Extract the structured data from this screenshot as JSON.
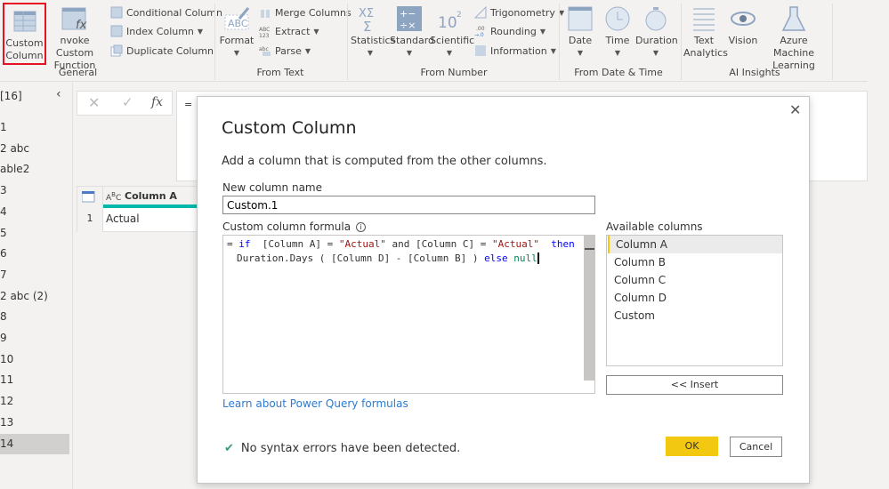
{
  "ribbon": {
    "custom_column": [
      "Custom",
      "Column"
    ],
    "invoke_custom_function": [
      "nvoke Custom",
      "Function"
    ],
    "conditional_column": "Conditional Column",
    "index_column": "Index Column",
    "duplicate_column": "Duplicate Column",
    "general": "General",
    "format": "Format",
    "merge_columns": "Merge Columns",
    "extract": "Extract",
    "parse": "Parse",
    "from_text": "From Text",
    "statistics": "Statistics",
    "standard": "Standard",
    "scientific": "Scientific",
    "trigonometry": "Trigonometry",
    "rounding": "Rounding",
    "information": "Information",
    "from_number": "From Number",
    "date": "Date",
    "time": "Time",
    "duration": "Duration",
    "from_date_time": "From Date & Time",
    "text_analytics": [
      "Text",
      "Analytics"
    ],
    "vision": "Vision",
    "azure_ml": [
      "Azure Machine",
      "Learning"
    ],
    "ai_insights": "AI Insights",
    "highlight_color": "#e81123"
  },
  "sidebar": {
    "header": "[16]",
    "items": [
      "1",
      "2 abc",
      "able2",
      "3",
      "4",
      "5",
      "6",
      "7",
      "2 abc (2)",
      "8",
      "9",
      "10",
      "11",
      "12",
      "13",
      "14"
    ],
    "selected_index": 15
  },
  "formula_bar": {
    "prefix": "=",
    "fx": "fx"
  },
  "grid": {
    "column_header": "Column A",
    "type_icon": "ABC",
    "rows": [
      {
        "num": "1",
        "value": "Actual"
      }
    ]
  },
  "dialog": {
    "title": "Custom Column",
    "description": "Add a column that is computed from the other columns.",
    "new_column_name_label": "New column name",
    "new_column_name_value": "Custom.1",
    "formula_label": "Custom column formula",
    "formula": {
      "eq": "= ",
      "if": "if",
      "p1": "  [Column A] = ",
      "s1": "\"Actual\"",
      "p2": " and [Column C] = ",
      "s2": "\"Actual\"",
      "then": "  then",
      "line2": "Duration.Days ( [Column D] - [Column B] ) ",
      "else": "else",
      "null": "null"
    },
    "available_columns_label": "Available columns",
    "available_columns": [
      "Column A",
      "Column B",
      "Column C",
      "Column D",
      "Custom"
    ],
    "selected_column": "Column A",
    "insert_label": "<< Insert",
    "learn_link": "Learn about Power Query formulas",
    "status": "No syntax errors have been detected.",
    "ok_label": "OK",
    "cancel_label": "Cancel",
    "ok_color": "#f2c811",
    "accent": "#01b8aa"
  }
}
